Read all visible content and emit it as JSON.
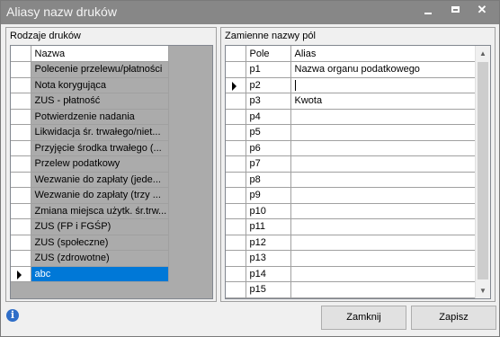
{
  "window": {
    "title": "Aliasy nazw druków",
    "minimize_glyph": "",
    "close_glyph": "✕"
  },
  "left_panel": {
    "title": "Rodzaje druków",
    "column_header": "Nazwa",
    "rows": [
      "Polecenie przelewu/płatności",
      "Nota korygująca",
      "ZUS - płatność",
      "Potwierdzenie nadania",
      "Likwidacja śr. trwałego/niet...",
      "Przyjęcie środka trwałego (...",
      "Przelew podatkowy",
      "Wezwanie do zapłaty (jede...",
      "Wezwanie do zapłaty (trzy ...",
      "Zmiana miejsca użytk. śr.trw...",
      "ZUS (FP i FGŚP)",
      "ZUS (społeczne)",
      "ZUS (zdrowotne)",
      "abc"
    ],
    "selected_index": 13
  },
  "right_panel": {
    "title": "Zamienne nazwy pól",
    "headers": {
      "pole": "Pole",
      "alias": "Alias"
    },
    "rows": [
      {
        "pole": "p1",
        "alias": "Nazwa organu podatkowego"
      },
      {
        "pole": "p2",
        "alias": ""
      },
      {
        "pole": "p3",
        "alias": "Kwota"
      },
      {
        "pole": "p4",
        "alias": ""
      },
      {
        "pole": "p5",
        "alias": ""
      },
      {
        "pole": "p6",
        "alias": ""
      },
      {
        "pole": "p7",
        "alias": ""
      },
      {
        "pole": "p8",
        "alias": ""
      },
      {
        "pole": "p9",
        "alias": ""
      },
      {
        "pole": "p10",
        "alias": ""
      },
      {
        "pole": "p11",
        "alias": ""
      },
      {
        "pole": "p12",
        "alias": ""
      },
      {
        "pole": "p13",
        "alias": ""
      },
      {
        "pole": "p14",
        "alias": ""
      },
      {
        "pole": "p15",
        "alias": ""
      }
    ],
    "current_index": 1
  },
  "buttons": {
    "close_label": "Zamknij",
    "save_label": "Zapisz"
  },
  "info_glyph": "i"
}
